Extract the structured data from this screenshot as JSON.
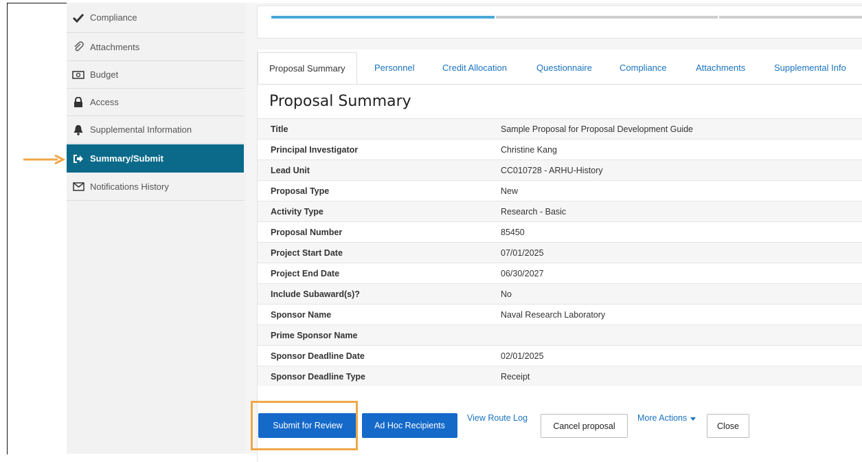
{
  "sidebar": {
    "items": [
      {
        "label": "Compliance",
        "icon": "check-icon"
      },
      {
        "label": "Attachments",
        "icon": "paperclip-icon"
      },
      {
        "label": "Budget",
        "icon": "money-icon"
      },
      {
        "label": "Access",
        "icon": "lock-icon"
      },
      {
        "label": "Supplemental Information",
        "icon": "bell-icon"
      },
      {
        "label": "Summary/Submit",
        "icon": "sign-out-icon"
      },
      {
        "label": "Notifications History",
        "icon": "envelope-icon"
      }
    ],
    "active_index": 5
  },
  "tabs": [
    "Proposal Summary",
    "Personnel",
    "Credit Allocation",
    "Questionnaire",
    "Compliance",
    "Attachments",
    "Supplemental Info"
  ],
  "page_title": "Proposal Summary",
  "summary_rows": [
    {
      "key": "Title",
      "value": "Sample Proposal for Proposal Development Guide"
    },
    {
      "key": "Principal Investigator",
      "value": "Christine Kang"
    },
    {
      "key": "Lead Unit",
      "value": "CC010728 - ARHU-History"
    },
    {
      "key": "Proposal Type",
      "value": "New"
    },
    {
      "key": "Activity Type",
      "value": "Research - Basic"
    },
    {
      "key": "Proposal Number",
      "value": "85450"
    },
    {
      "key": "Project Start Date",
      "value": "07/01/2025"
    },
    {
      "key": "Project End Date",
      "value": "06/30/2027"
    },
    {
      "key": "Include Subaward(s)?",
      "value": "No"
    },
    {
      "key": "Sponsor Name",
      "value": "Naval Research Laboratory"
    },
    {
      "key": "Prime Sponsor Name",
      "value": ""
    },
    {
      "key": "Sponsor Deadline Date",
      "value": "02/01/2025"
    },
    {
      "key": "Sponsor Deadline Type",
      "value": "Receipt"
    }
  ],
  "actions": {
    "submit": "Submit for Review",
    "adhoc": "Ad Hoc Recipients",
    "route_log": "View Route Log",
    "cancel": "Cancel proposal",
    "more": "More Actions",
    "close": "Close"
  },
  "colors": {
    "active_sidebar": "#0b6a8a",
    "primary_button": "#1469c9",
    "link": "#1a73c0",
    "annotation": "#f0a848",
    "progress_fill": "#4aa8d8"
  }
}
